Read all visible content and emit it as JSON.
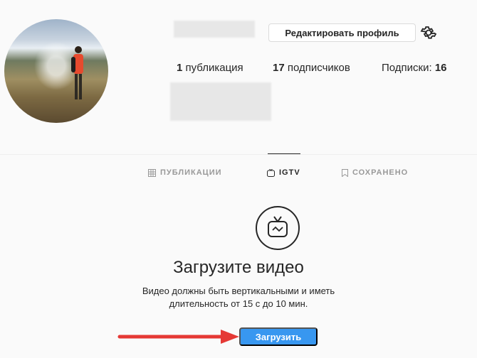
{
  "profile": {
    "edit_button": "Редактировать профиль",
    "stats": [
      {
        "count": "1",
        "label": " публикация"
      },
      {
        "count": "17",
        "label": " подписчиков"
      },
      {
        "label": "Подписки: ",
        "count": "16"
      }
    ]
  },
  "tabs": [
    {
      "label": "ПУБЛИКАЦИИ",
      "icon": "grid-icon"
    },
    {
      "label": "IGTV",
      "icon": "igtv-icon"
    },
    {
      "label": "СОХРАНЕНО",
      "icon": "bookmark-icon"
    }
  ],
  "igtv": {
    "title": "Загрузите видео",
    "desc_line1": "Видео должны быть вертикальными и иметь",
    "desc_line2": "длительность от 15 с до 10 мин.",
    "upload_button": "Загрузить"
  },
  "colors": {
    "accent": "#3897f0",
    "arrow": "#e53935"
  }
}
